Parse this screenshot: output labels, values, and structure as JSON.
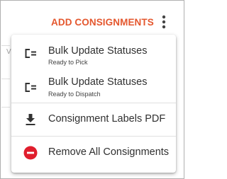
{
  "header": {
    "add_consignments_label": "ADD CONSIGNMENTS",
    "more_icon": "more-vert-icon"
  },
  "background": {
    "partial_letter": "V"
  },
  "menu": {
    "items": [
      {
        "label": "Bulk Update Statuses",
        "sublabel": "Ready to Pick",
        "icon": "list-indent-icon"
      },
      {
        "label": "Bulk Update Statuses",
        "sublabel": "Ready to Dispatch",
        "icon": "list-indent-icon"
      },
      {
        "label": "Consignment Labels PDF",
        "icon": "download-icon"
      },
      {
        "label": "Remove All Consignments",
        "icon": "remove-circle-icon",
        "icon_color": "#e01e2d"
      }
    ]
  },
  "colors": {
    "accent": "#e4572e",
    "danger": "#e01e2d"
  }
}
